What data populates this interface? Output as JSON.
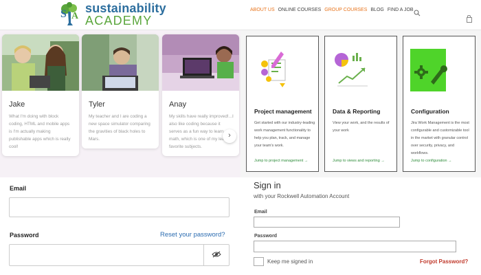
{
  "header": {
    "logo_line1": "sustainability",
    "logo_line2": "ACADEMY",
    "nav": [
      {
        "label": "ABOUT US"
      },
      {
        "label": "ONLINE COURSES"
      },
      {
        "label": "GROUP COURSES"
      },
      {
        "label": "BLOG"
      },
      {
        "label": "FIND A JOB"
      }
    ],
    "icons": {
      "search": "search-icon",
      "cart": "cart-icon"
    },
    "colors": {
      "accent": "#e8741c",
      "brand_blue": "#2c6e9e",
      "brand_green": "#5aa63c"
    }
  },
  "students": [
    {
      "name": "Jake",
      "text": "What I'm doing with block coding, HTML and mobile apps is I'm actually making publishable apps which is really cool!"
    },
    {
      "name": "Tyler",
      "text": "My teacher and I are coding a new space simulator comparing the gravities of black holes to Mars."
    },
    {
      "name": "Anay",
      "text": "My skills have really improved!...I also like coding because it serves as a fun way to learn math, which is one of my least favorite subjects."
    }
  ],
  "features": [
    {
      "title": "Project management",
      "desc": "Get started with our industry-leading work management functionality to help you plan, track, and manage your team's work.",
      "link": "Jump to project management →"
    },
    {
      "title": "Data & Reporting",
      "desc": "View your work, and the results of your work",
      "link": "Jump to views and reporting →"
    },
    {
      "title": "Configuration",
      "desc": "Jira Work Management is the most configurable and customizable tool in the market with granular control over security, privacy, and workflows.",
      "link": "Jump to configuration →"
    }
  ],
  "left_form": {
    "email_label": "Email",
    "password_label": "Password",
    "reset_link": "Reset your password?"
  },
  "signin": {
    "title": "Sign in",
    "subtitle": "with your Rockwell Automation Account",
    "email_label": "Email",
    "password_label": "Password",
    "keep_signed_in": "Keep me signed in",
    "forgot_password": "Forgot Password?"
  }
}
